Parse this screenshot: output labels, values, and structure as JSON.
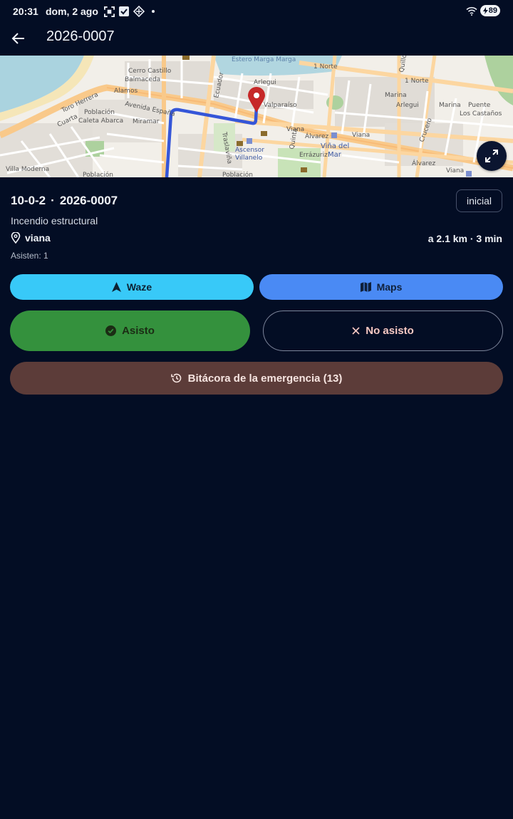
{
  "status_bar": {
    "time": "20:31",
    "date": "dom, 2 ago",
    "battery": "89",
    "icons": [
      "screenshot-icon",
      "check-box-icon",
      "diamond-app-icon",
      "wifi-icon",
      "battery-charging-icon"
    ]
  },
  "app_bar": {
    "title": "2026-0007",
    "back_icon": "arrow-left-icon"
  },
  "map": {
    "labels": {
      "cerro_castillo": "Cerro Castillo",
      "alamos": "Alamos",
      "balmaceda": "Balmaceda",
      "avenida_espana": "Avenida España",
      "miramar": "Miramar",
      "miramar2": "Miramar",
      "poblacion": "Población",
      "caleta_abarca": "Caleta Abarca",
      "torres": "Toro Herrera",
      "cuarta": "Cuarta",
      "villa_moderna": "Villa Moderna",
      "poblacion2": "Población",
      "ecuador": "Ecuador",
      "arlegui": "Arlegui",
      "valparaiso": "Valparaíso",
      "viana": "Viana",
      "alvarez": "Álvarez",
      "vina_del": "Viña del",
      "mar": "Mar",
      "ascensor": "Ascensor",
      "villanelo": "Villanelo",
      "poblacion3": "Población",
      "quinta": "Quinta",
      "errazuriz": "Errázuriz",
      "uno_norte": "1 Norte",
      "uno_norte2": "1 Norte",
      "estero": "Estero Marga Marga",
      "marina": "Marina",
      "arlegui2": "Arlegui",
      "marina2": "Marina",
      "puente": "Puente",
      "los_castanos": "Los Castaños",
      "alvarez2": "Álvarez",
      "viana2": "Viana",
      "viana3": "Viana",
      "crucero": "Crucero",
      "quillota": "Quillota",
      "traslaviña": "Traslaviña"
    },
    "expand_icon": "expand-icon",
    "pin_icon": "location-pin-icon"
  },
  "incident": {
    "code": "10-0-2",
    "separator": "·",
    "number": "2026-0007",
    "state": "inicial",
    "type": "Incendio estructural",
    "location": "viana",
    "distance": "a 2.1 km · 3 min",
    "attendees": "Asisten: 1"
  },
  "actions": {
    "waze": "Waze",
    "maps": "Maps",
    "attend": "Asisto",
    "not_attend": "No asisto",
    "log": "Bitácora de la emergencia (13)"
  },
  "colors": {
    "background": "#030d24",
    "waze": "#38c9f8",
    "maps": "#4a8af4",
    "attend": "#34913d",
    "log": "#5c3c39",
    "pin": "#c62828",
    "route": "#3556d8"
  }
}
